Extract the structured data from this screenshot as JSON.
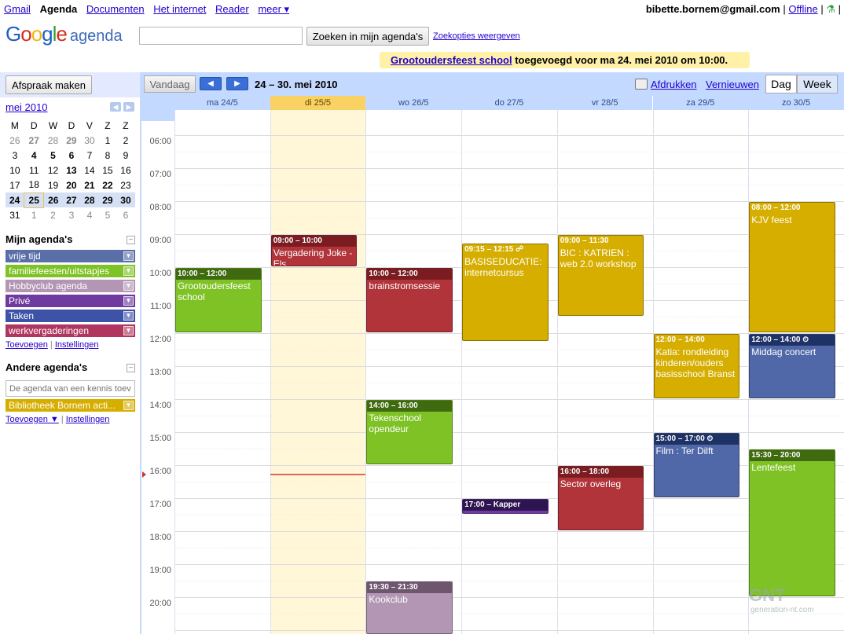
{
  "topnav": {
    "items": [
      "Gmail",
      "Agenda",
      "Documenten",
      "Het internet",
      "Reader",
      "meer ▾"
    ],
    "email": "bibette.bornem@gmail.com",
    "offline": "Offline",
    "sep": "|"
  },
  "logo": {
    "g1": "G",
    "g2": "o",
    "g3": "o",
    "g4": "g",
    "g5": "l",
    "g6": "e",
    "suffix": "agenda"
  },
  "search": {
    "value": "",
    "button": "Zoeken in mijn agenda's",
    "options": "Zoekopties weergeven"
  },
  "notification": {
    "link": "Grootoudersfeest school",
    "text": " toegevoegd voor ma 24. mei 2010 om 10:00."
  },
  "sidebar": {
    "create_label": "Afspraak maken",
    "mini_title": "mei 2010",
    "weekdays": [
      "M",
      "D",
      "W",
      "D",
      "V",
      "Z",
      "Z"
    ],
    "weeks": [
      [
        "26",
        "27",
        "28",
        "29",
        "30",
        "1",
        "2"
      ],
      [
        "3",
        "4",
        "5",
        "6",
        "7",
        "8",
        "9"
      ],
      [
        "10",
        "11",
        "12",
        "13",
        "14",
        "15",
        "16"
      ],
      [
        "17",
        "18",
        "19",
        "20",
        "21",
        "22",
        "23"
      ],
      [
        "24",
        "25",
        "26",
        "27",
        "28",
        "29",
        "30"
      ],
      [
        "31",
        "1",
        "2",
        "3",
        "4",
        "5",
        "6"
      ]
    ],
    "my_title": "Mijn agenda's",
    "my_calendars": [
      {
        "name": "vrije tijd",
        "color": "#5a6ea8"
      },
      {
        "name": "familiefeesten/uitstapjes",
        "color": "#7ec225"
      },
      {
        "name": "Hobbyclub agenda",
        "color": "#b396b3"
      },
      {
        "name": "Privé",
        "color": "#6f3ba0"
      },
      {
        "name": "Taken",
        "color": "#3d53a8"
      },
      {
        "name": "werkvergaderingen",
        "color": "#b1365f"
      }
    ],
    "my_add": "Toevoegen",
    "my_settings": "Instellingen",
    "other_title": "Andere agenda's",
    "friend_placeholder": "De agenda van een kennis toevoegen",
    "other_calendars": [
      {
        "name": "Bibliotheek Bornem acti...",
        "color": "#d6ae00"
      }
    ],
    "other_add": "Toevoegen ▼",
    "other_settings": "Instellingen"
  },
  "main": {
    "today_label": "Vandaag",
    "prev": "◀",
    "next": "▶",
    "range": "24 – 30. mei 2010",
    "print": "Afdrukken",
    "refresh": "Vernieuwen",
    "tab_day": "Dag",
    "tab_week": "Week",
    "days": [
      "ma 24/5",
      "di 25/5",
      "wo 26/5",
      "do 27/5",
      "vr 28/5",
      "za 29/5",
      "zo 30/5"
    ],
    "today_index": 1,
    "hours": [
      "06:00",
      "07:00",
      "08:00",
      "09:00",
      "10:00",
      "11:00",
      "12:00",
      "13:00",
      "14:00",
      "15:00",
      "16:00",
      "17:00",
      "18:00",
      "19:00",
      "20:00"
    ],
    "now_hour": 16.25
  },
  "events": [
    {
      "day": 0,
      "start": 10,
      "end": 12,
      "time": "10:00 – 12:00",
      "title": "Grootoudersfeest school",
      "color": "#7ec225",
      "head": "#3f6a10"
    },
    {
      "day": 1,
      "start": 9,
      "end": 10,
      "time": "09:00 – 10:00",
      "title": "Vergadering Joke - Els",
      "color": "#b0343a",
      "head": "#7a1c20"
    },
    {
      "day": 2,
      "start": 10,
      "end": 12,
      "time": "10:00 – 12:00",
      "title": "brainstromsessie",
      "color": "#b0343a",
      "head": "#7a1c20"
    },
    {
      "day": 2,
      "start": 14,
      "end": 16,
      "time": "14:00 – 16:00",
      "title": "Tekenschool opendeur",
      "color": "#7ec225",
      "head": "#3f6a10"
    },
    {
      "day": 2,
      "start": 19.5,
      "end": 21.5,
      "time": "19:30 – 21:30",
      "title": "Kookclub",
      "color": "#b396b3",
      "head": "#6e566e"
    },
    {
      "day": 3,
      "start": 9.25,
      "end": 12.25,
      "time": "09:15 – 12:15 ☍",
      "title": "BASISEDUCATIE: internetcursus",
      "color": "#d6ae00",
      "head": "#d6ae00"
    },
    {
      "day": 3,
      "start": 17,
      "end": 17.5,
      "time": "17:00 – Kapper",
      "title": "",
      "color": "#6f3ba0",
      "head": "#2e1450"
    },
    {
      "day": 4,
      "start": 9,
      "end": 11.5,
      "time": "09:00 – 11:30",
      "title": "BIC : KATRIEN : web 2.0 workshop",
      "color": "#d6ae00",
      "head": "#d6ae00"
    },
    {
      "day": 4,
      "start": 16,
      "end": 18,
      "time": "16:00 – 18:00",
      "title": "Sector overleg",
      "color": "#b0343a",
      "head": "#7a1c20"
    },
    {
      "day": 5,
      "start": 12,
      "end": 14,
      "time": "12:00 – 14:00",
      "title": "Katia: rondleiding kinderen/ouders basisschool Branst",
      "color": "#d6ae00",
      "head": "#d6ae00"
    },
    {
      "day": 5,
      "start": 15,
      "end": 17,
      "time": "15:00 – 17:00 ⏲",
      "title": "Film : Ter Dilft",
      "color": "#5068a8",
      "head": "#1e3266"
    },
    {
      "day": 6,
      "start": 8,
      "end": 12,
      "time": "08:00 – 12:00",
      "title": "KJV feest",
      "color": "#d6ae00",
      "head": "#d6ae00"
    },
    {
      "day": 6,
      "start": 12,
      "end": 14,
      "time": "12:00 – 14:00 ⏲",
      "title": "Middag concert",
      "color": "#5068a8",
      "head": "#1e3266"
    },
    {
      "day": 6,
      "start": 15.5,
      "end": 20,
      "time": "15:30 – 20:00",
      "title": "Lentefeest",
      "color": "#7ec225",
      "head": "#3f6a10"
    }
  ],
  "watermark": {
    "main": "GNT",
    "sub": "generation-nt.com"
  }
}
